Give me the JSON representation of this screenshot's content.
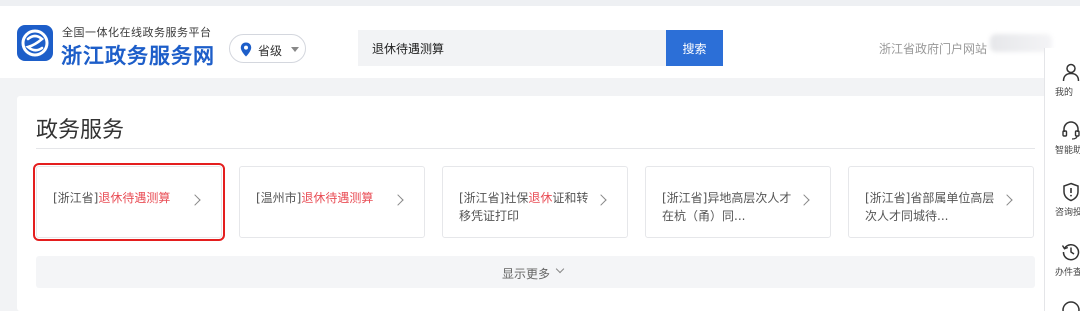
{
  "header": {
    "platform_subtitle": "全国一体化在线政务服务平台",
    "site_name": "浙江政务服务网",
    "region_label": "省级",
    "search_value": "退休待遇测算",
    "search_button": "搜索",
    "portal_link": "浙江省政府门户网站"
  },
  "main": {
    "section_title": "政务服务",
    "results": [
      {
        "prefix": "[浙江省]",
        "highlight": "退休待遇测算",
        "suffix": "",
        "selected": true
      },
      {
        "prefix": "[温州市]",
        "highlight": "退休待遇测算",
        "suffix": "",
        "selected": false
      },
      {
        "prefix": "[浙江省]社保",
        "highlight": "退休",
        "suffix": "证和转移凭证打印",
        "selected": false
      },
      {
        "prefix": "[浙江省]异地高层次人才在杭（甬）同...",
        "highlight": "",
        "suffix": "",
        "selected": false
      },
      {
        "prefix": "[浙江省]省部属单位高层次人才同城待...",
        "highlight": "",
        "suffix": "",
        "selected": false
      }
    ],
    "show_more": "显示更多"
  },
  "side_rail": {
    "items": [
      {
        "icon": "user-icon",
        "label": "我的"
      },
      {
        "icon": "headset-icon",
        "label": "智能助"
      },
      {
        "icon": "shield-icon",
        "label": "咨询投"
      },
      {
        "icon": "history-icon",
        "label": "办件查"
      }
    ]
  },
  "colors": {
    "brand_blue": "#1d5ec9",
    "button_blue": "#2c6fd7",
    "highlight_red": "#e94d55",
    "selection_red": "#e41e1e"
  }
}
